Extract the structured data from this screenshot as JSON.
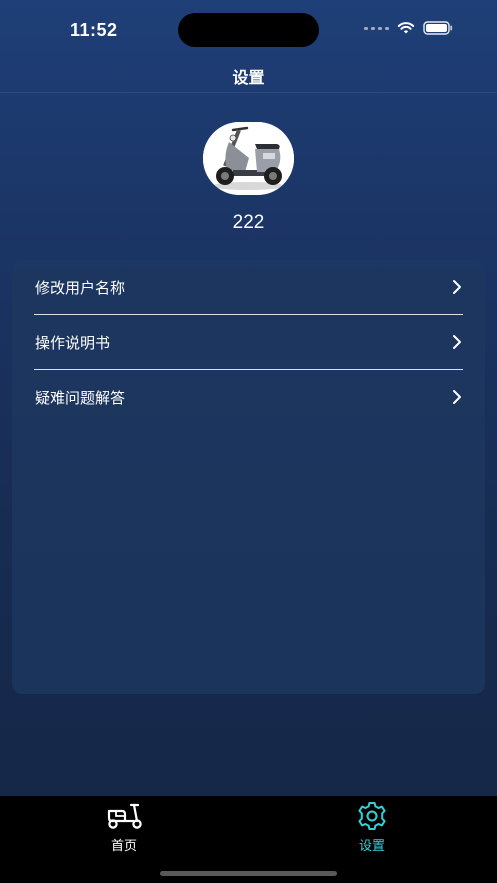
{
  "status_bar": {
    "time": "11:52",
    "icons": [
      "signal-icon",
      "wifi-icon",
      "battery-icon"
    ]
  },
  "header": {
    "title": "设置"
  },
  "profile": {
    "avatar_icon": "scooter-avatar",
    "username": "222"
  },
  "menu": {
    "items": [
      {
        "label": "修改用户名称",
        "icon": "chevron-right-icon"
      },
      {
        "label": "操作说明书",
        "icon": "chevron-right-icon"
      },
      {
        "label": "疑难问题解答",
        "icon": "chevron-right-icon"
      }
    ]
  },
  "tab_bar": {
    "tabs": [
      {
        "label": "首页",
        "icon": "scooter-icon",
        "active": false
      },
      {
        "label": "设置",
        "icon": "gear-icon",
        "active": true
      }
    ]
  },
  "colors": {
    "background_top": "#1f3f78",
    "background_bottom": "#142645",
    "active_tab": "#35d0d6",
    "inactive_tab": "#ffffff",
    "tab_bar": "#000000"
  }
}
